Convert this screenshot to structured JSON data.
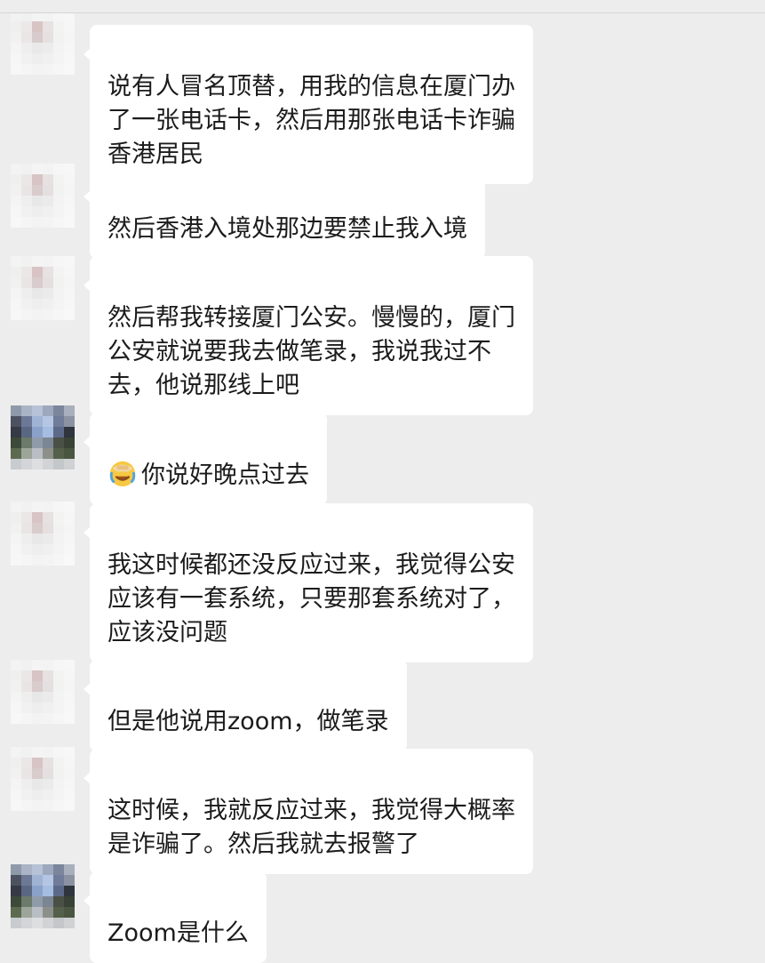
{
  "colors": {
    "background": "#ededed",
    "bubble": "#ffffff",
    "text": "#1b1b1b"
  },
  "messages": [
    {
      "avatar": "user-a",
      "text": "说有人冒名顶替，用我的信息在厦门办\n了一张电话卡，然后用那张电话卡诈骗\n香港居民"
    },
    {
      "avatar": "user-a",
      "text": "然后香港入境处那边要禁止我入境"
    },
    {
      "avatar": "user-a",
      "text": "然后帮我转接厦门公安。慢慢的，厦门\n公安就说要我去做笔录，我说我过不\n去，他说那线上吧"
    },
    {
      "avatar": "user-b",
      "emoji": "facepalm-emoji",
      "text": "你说好晚点过去"
    },
    {
      "avatar": "user-a",
      "text": "我这时候都还没反应过来，我觉得公安\n应该有一套系统，只要那套系统对了，\n应该没问题"
    },
    {
      "avatar": "user-a",
      "text": "但是他说用zoom，做笔录"
    },
    {
      "avatar": "user-a",
      "text": "这时候，我就反应过来，我觉得大概率\n是诈骗了。然后我就去报警了"
    },
    {
      "avatar": "user-b",
      "text": "Zoom是什么"
    }
  ]
}
